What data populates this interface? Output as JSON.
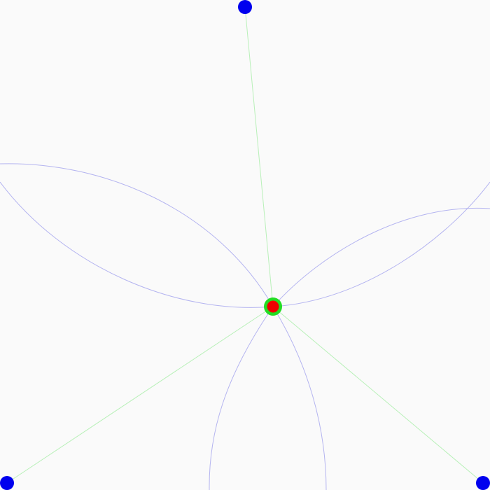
{
  "diagram": {
    "colors": {
      "background": "#fafafa",
      "anchor_fill": "#0000ee",
      "spoke_stroke": "#b8f0b8",
      "arc_stroke": "#b4b4f0",
      "center_ring": "#22dd22",
      "center_fill": "#ee0000"
    },
    "center": {
      "name": "center-node"
    },
    "anchors": [
      {
        "name": "anchor-node-top"
      },
      {
        "name": "anchor-node-bottom-left"
      },
      {
        "name": "anchor-node-bottom-right"
      }
    ],
    "petals": [
      {
        "name": "petal-upper-left"
      },
      {
        "name": "petal-upper-right"
      },
      {
        "name": "petal-lower"
      }
    ]
  }
}
